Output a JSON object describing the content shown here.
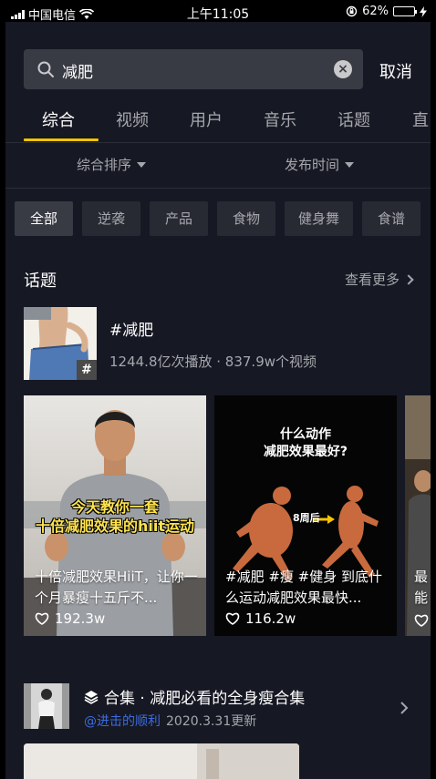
{
  "status_bar": {
    "carrier": "中国电信",
    "time": "上午11:05",
    "battery_percent": "62%",
    "battery_level": 0.62
  },
  "search": {
    "query": "减肥",
    "cancel_label": "取消"
  },
  "tabs": [
    "综合",
    "视频",
    "用户",
    "音乐",
    "话题",
    "直"
  ],
  "sort": {
    "left": "综合排序",
    "right": "发布时间"
  },
  "chips": [
    "全部",
    "逆袭",
    "产品",
    "食物",
    "健身舞",
    "食谱"
  ],
  "topics_section": {
    "title": "话题",
    "see_more": "查看更多"
  },
  "topic": {
    "name": "#减肥",
    "stats": "1244.8亿次播放 · 837.9w个视频",
    "badge": "#"
  },
  "videos": [
    {
      "overlay_caption": "今天教你一套\n十倍减肥效果的hiit运动",
      "description": "十倍减肥效果HiiT，让你一个月暴瘦十五斤不...",
      "likes": "192.3w"
    },
    {
      "overlay_caption": "什么动作\n减肥效果最好?",
      "overlay_label": "8周后",
      "description": "#减肥 #瘦 #健身 到底什么运动减肥效果最快...",
      "likes": "116.2w"
    },
    {
      "description": "最能",
      "likes": ""
    }
  ],
  "collection": {
    "title": "合集 · 减肥必看的全身瘦合集",
    "author": "@进击的顺利",
    "date": "2020.3.31更新"
  },
  "colors": {
    "background": "#161823",
    "accent": "#f5c400",
    "link": "#3d6ce0",
    "muted_text": "#a6a7ad"
  }
}
